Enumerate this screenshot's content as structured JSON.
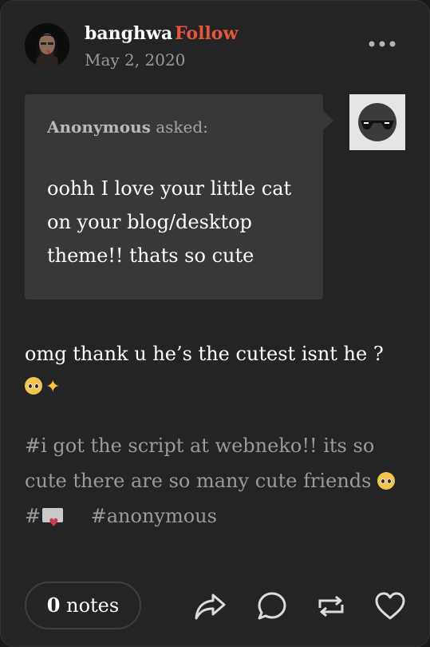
{
  "post": {
    "username": "banghwa",
    "follow_label": "Follow",
    "date": "May 2, 2020",
    "more_icon": "more-horizontal-icon"
  },
  "ask": {
    "asker_name": "Anonymous",
    "asked_label": "asked:",
    "question": "oohh I love your little cat on your blog/desktop theme!! thats so cute",
    "anon_avatar_icon": "anonymous-sunglasses-avatar"
  },
  "answer": {
    "text": "omg thank u he’s the cutest isnt he ?",
    "emojis": [
      "pleading-face-emoji",
      "sparkles-emoji"
    ]
  },
  "tags": {
    "items": [
      "#i got the script at webneko!! its so cute there are so many cute friends",
      "#",
      "#anonymous"
    ]
  },
  "footer": {
    "notes_count": "0",
    "notes_label": "notes",
    "actions": [
      "share-icon",
      "reply-icon",
      "reblog-icon",
      "like-icon"
    ]
  },
  "colors": {
    "background": "#242424",
    "accent": "#e4573c",
    "ask_box": "#383838",
    "muted_text": "#9a9a9a"
  }
}
